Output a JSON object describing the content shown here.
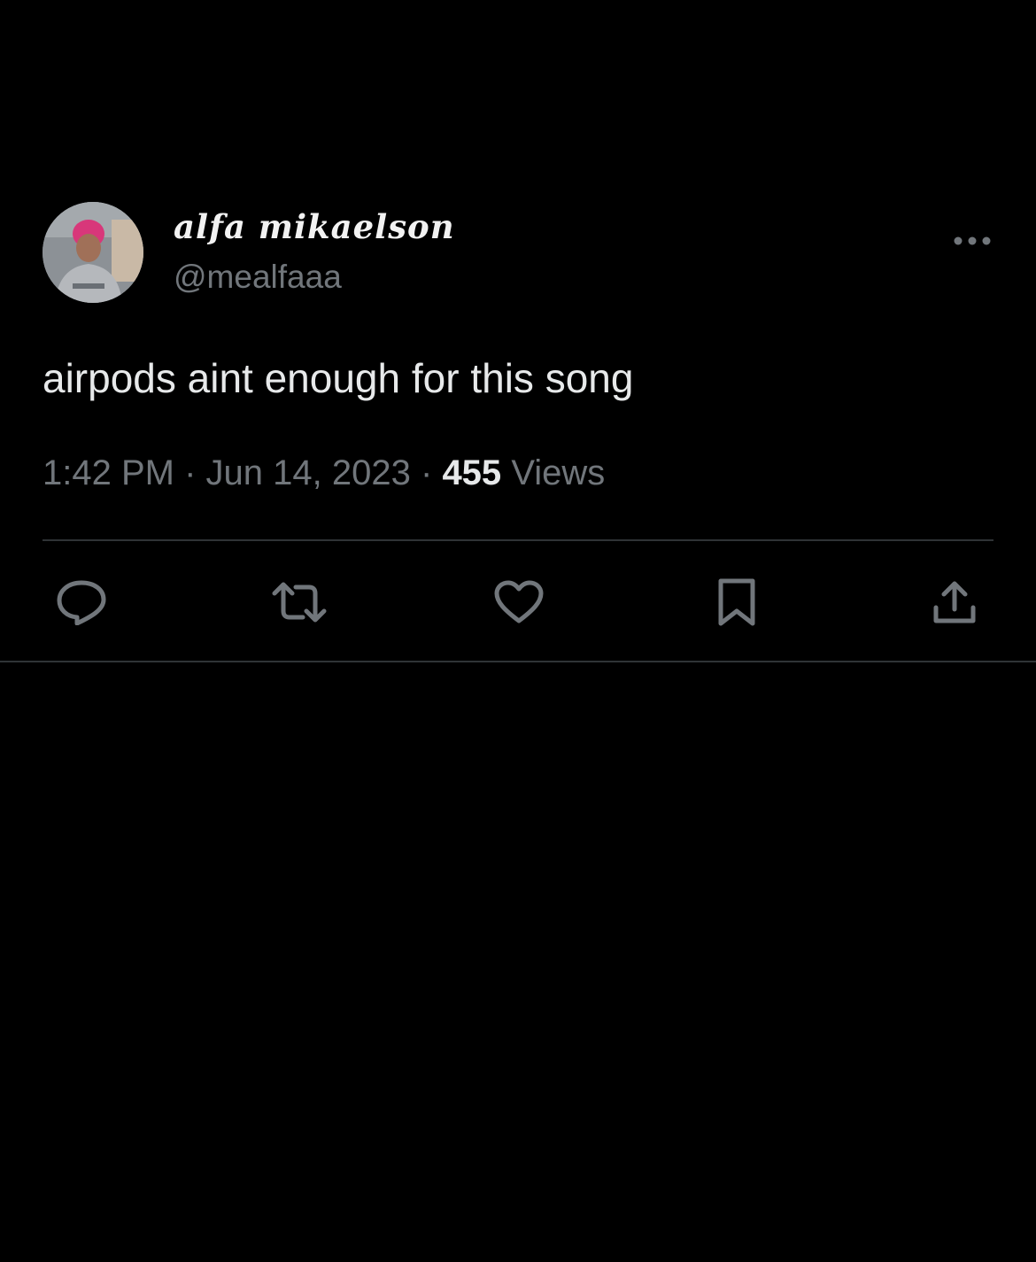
{
  "author": {
    "display_name": "alfa mikaelson",
    "handle": "@mealfaaa"
  },
  "tweet": {
    "text": "airpods aint enough for this song",
    "time": "1:42 PM",
    "separator": "·",
    "date": "Jun 14, 2023",
    "views_count": "455",
    "views_label": "Views"
  },
  "icons": {
    "more": "more-horizontal-icon",
    "reply": "reply-icon",
    "retweet": "retweet-icon",
    "like": "heart-icon",
    "bookmark": "bookmark-icon",
    "share": "share-icon"
  },
  "colors": {
    "background": "#000000",
    "primary_text": "#e7e9ea",
    "secondary_text": "#71767b",
    "divider": "#2f3336"
  }
}
